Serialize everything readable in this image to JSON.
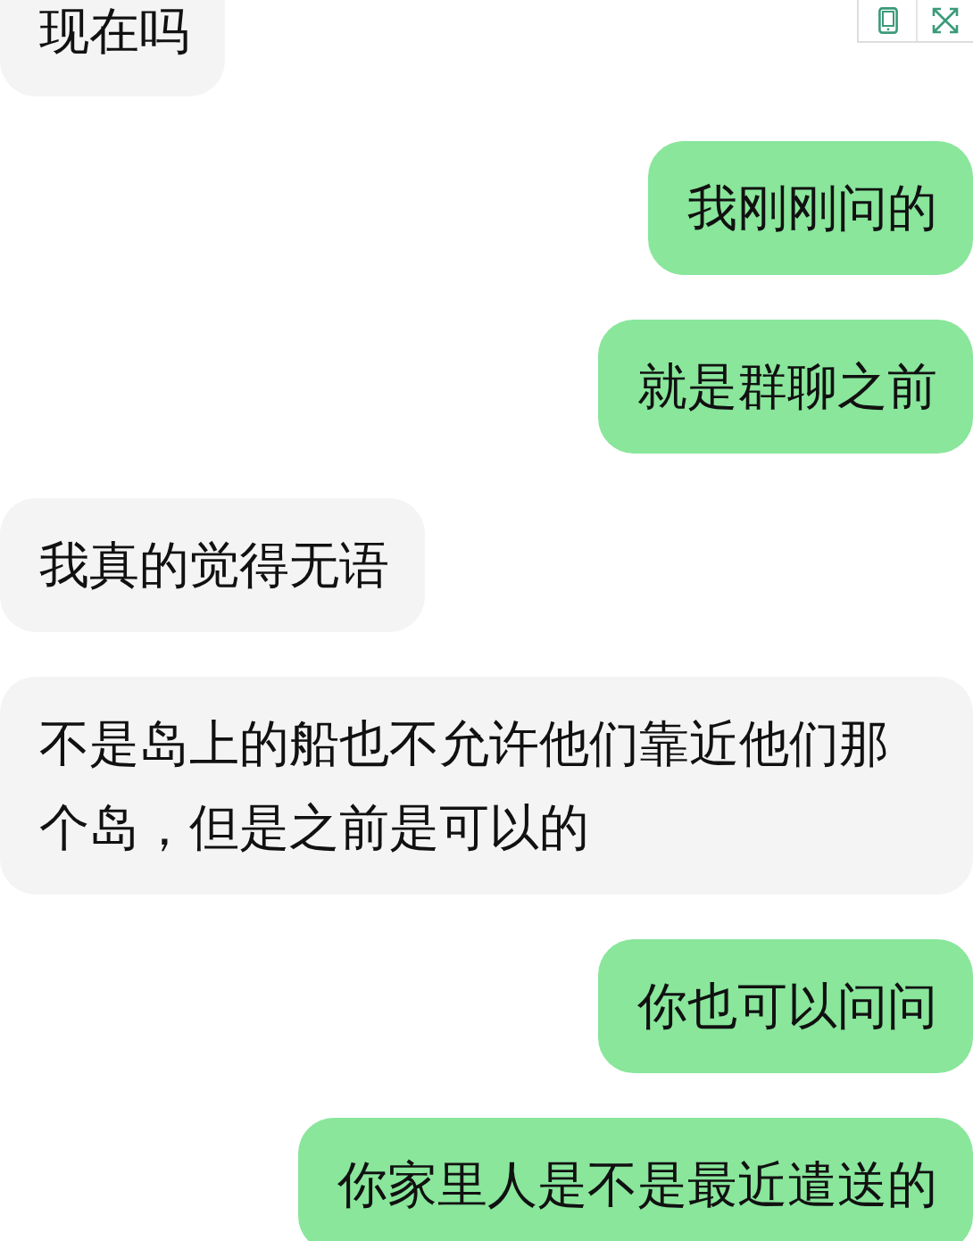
{
  "messages": [
    {
      "kind": "incoming",
      "text": "现在吗"
    },
    {
      "kind": "outgoing",
      "text": "我刚刚问的"
    },
    {
      "kind": "outgoing",
      "text": "就是群聊之前"
    },
    {
      "kind": "incoming",
      "text": "我真的觉得无语"
    },
    {
      "kind": "incoming",
      "text": "不是岛上的船也不允许他们靠近他们那个岛，但是之前是可以的"
    },
    {
      "kind": "outgoing",
      "text": "你也可以问问"
    },
    {
      "kind": "outgoing",
      "text": "你家里人是不是最近遣送的"
    }
  ]
}
